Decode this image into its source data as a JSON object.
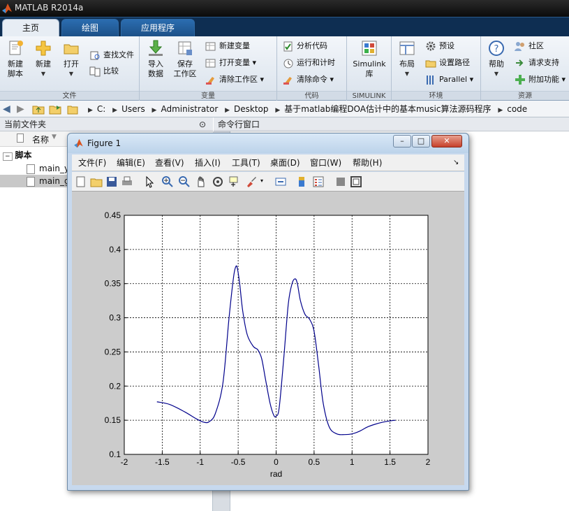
{
  "window": {
    "title": "MATLAB R2014a"
  },
  "tabs": [
    {
      "label": "主页"
    },
    {
      "label": "绘图"
    },
    {
      "label": "应用程序"
    }
  ],
  "ribbon": {
    "file_group": {
      "name": "文件",
      "new_script": [
        "新建",
        "脚本"
      ],
      "new": "新建",
      "open": "打开",
      "find_files": "查找文件",
      "compare": "比较"
    },
    "variable_group": {
      "name": "变量",
      "import": [
        "导入",
        "数据"
      ],
      "save": [
        "保存",
        "工作区"
      ],
      "new_variable": "新建变量",
      "open_variable": "打开变量",
      "clear_workspace": "清除工作区"
    },
    "code_group": {
      "name": "代码",
      "analyze": "分析代码",
      "run_time": "运行和计时",
      "clear_commands": "清除命令"
    },
    "simulink_group": {
      "name": "SIMULINK",
      "simulink": [
        "Simulink",
        "库"
      ]
    },
    "env_group": {
      "name": "环境",
      "layout": "布局",
      "preferences": "预设",
      "set_path": "设置路径",
      "parallel": "Parallel"
    },
    "resources_group": {
      "name": "资源",
      "help": "帮助",
      "community": "社区",
      "request_support": "请求支持",
      "addons": "附加功能"
    }
  },
  "address": {
    "segments": [
      "C:",
      "Users",
      "Administrator",
      "Desktop",
      "基于matlab编程DOA估计中的基本music算法源码程序",
      "code"
    ]
  },
  "left_panel": {
    "title": "当前文件夹",
    "column": "名称",
    "folder": "脚本",
    "files": [
      "main_y",
      "main_g"
    ]
  },
  "command_window": {
    "title": "命令行窗口"
  },
  "figure": {
    "title": "Figure 1",
    "menu": [
      "文件(F)",
      "编辑(E)",
      "查看(V)",
      "插入(I)",
      "工具(T)",
      "桌面(D)",
      "窗口(W)",
      "帮助(H)"
    ],
    "buttons": {
      "minimize": "–",
      "restore": "□",
      "close": "✕"
    }
  },
  "chart_data": {
    "type": "line",
    "xlabel": "rad",
    "ylabel": "",
    "title": "",
    "xlim": [
      -2,
      2
    ],
    "ylim": [
      0.1,
      0.45
    ],
    "xticks": [
      -2,
      -1.5,
      -1,
      -0.5,
      0,
      0.5,
      1,
      1.5,
      2
    ],
    "yticks": [
      0.1,
      0.15,
      0.2,
      0.25,
      0.3,
      0.35,
      0.4,
      0.45
    ],
    "xtick_labels": [
      "-2",
      "-1.5",
      "-1",
      "-0.5",
      "0",
      "0.5",
      "1",
      "1.5",
      "2"
    ],
    "ytick_labels": [
      "0.1",
      "0.15",
      "0.2",
      "0.25",
      "0.3",
      "0.35",
      "0.4",
      "0.45"
    ],
    "grid": true,
    "line_color": "#00008b",
    "series": [
      {
        "x": [
          -1.57,
          -1.4,
          -1.2,
          -1.05,
          -0.95,
          -0.88,
          -0.8,
          -0.7,
          -0.62,
          -0.56,
          -0.53,
          -0.51,
          -0.48,
          -0.44,
          -0.38,
          -0.3,
          -0.24,
          -0.19,
          -0.14,
          -0.08,
          -0.03,
          0.0,
          0.04,
          0.1,
          0.16,
          0.21,
          0.25,
          0.28,
          0.32,
          0.38,
          0.44,
          0.5,
          0.56,
          0.62,
          0.7,
          0.8,
          0.9,
          1.0,
          1.1,
          1.2,
          1.3,
          1.4,
          1.5,
          1.57
        ],
        "y": [
          0.177,
          0.173,
          0.162,
          0.152,
          0.147,
          0.148,
          0.16,
          0.205,
          0.3,
          0.36,
          0.375,
          0.372,
          0.35,
          0.31,
          0.275,
          0.258,
          0.253,
          0.24,
          0.21,
          0.175,
          0.157,
          0.156,
          0.168,
          0.24,
          0.32,
          0.35,
          0.357,
          0.35,
          0.325,
          0.305,
          0.298,
          0.28,
          0.23,
          0.175,
          0.14,
          0.13,
          0.129,
          0.13,
          0.134,
          0.14,
          0.144,
          0.147,
          0.149,
          0.15
        ]
      }
    ]
  }
}
